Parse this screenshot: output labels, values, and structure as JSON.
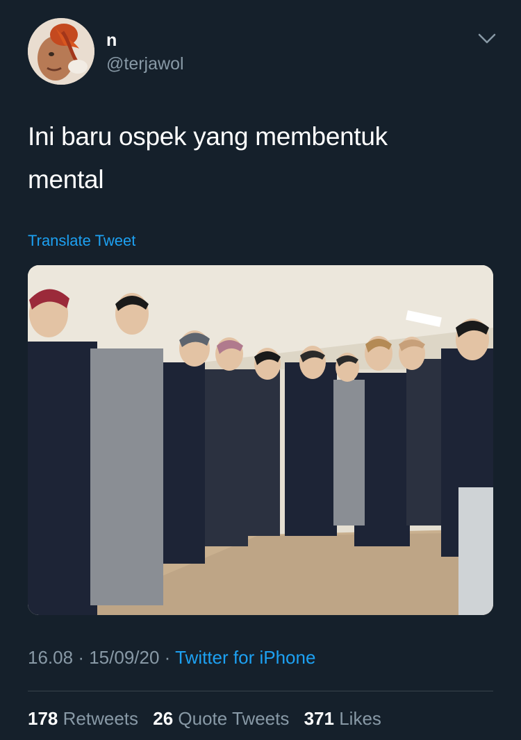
{
  "user": {
    "name": "n",
    "handle": "@terjawol",
    "avatar_icon": "profile-avatar"
  },
  "tweet": {
    "text_line1": "Ini baru ospek yang membentuk",
    "text_line2": "mental",
    "translate_label": "Translate Tweet",
    "media_icon": "photo-group-in-suits"
  },
  "meta": {
    "time": "16.08",
    "separator": "·",
    "date": "15/09/20",
    "source": "Twitter for iPhone"
  },
  "stats": {
    "retweets_count": "178",
    "retweets_label": "Retweets",
    "quotes_count": "26",
    "quotes_label": "Quote Tweets",
    "likes_count": "371",
    "likes_label": "Likes"
  },
  "colors": {
    "background": "#15202b",
    "accent": "#1da1f2",
    "secondary_text": "#8899a6",
    "divider": "#38444d"
  }
}
